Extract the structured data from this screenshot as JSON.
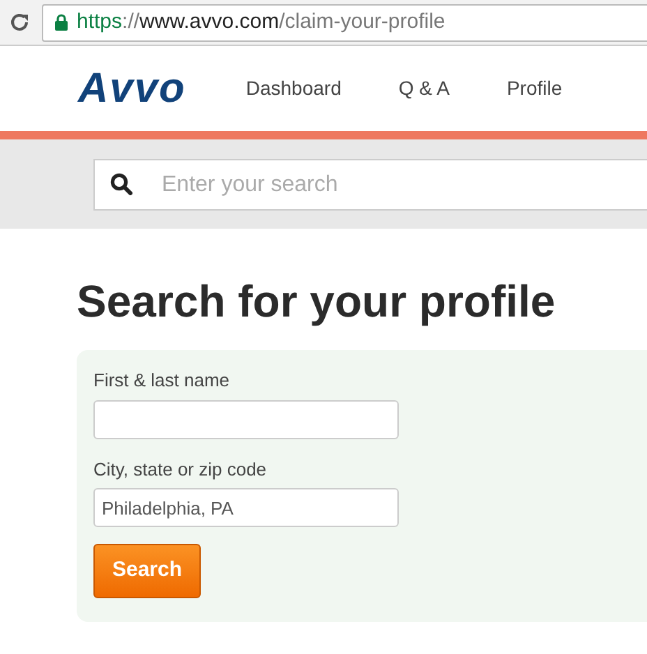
{
  "browser": {
    "address": {
      "scheme": "https",
      "separator": "://",
      "host": "www.avvo.com",
      "path": "/claim-your-profile"
    },
    "secure": true
  },
  "header": {
    "logo": "Avvo",
    "nav": [
      {
        "label": "Dashboard"
      },
      {
        "label": "Q & A"
      },
      {
        "label": "Profile"
      }
    ]
  },
  "search_bar": {
    "placeholder": "Enter your search"
  },
  "heading": "Search for your profile",
  "form": {
    "fields": [
      {
        "label": "First & last name"
      },
      {
        "label": "City, state or zip code",
        "value": "Philadelphia, PA"
      }
    ],
    "button": "Search"
  }
}
